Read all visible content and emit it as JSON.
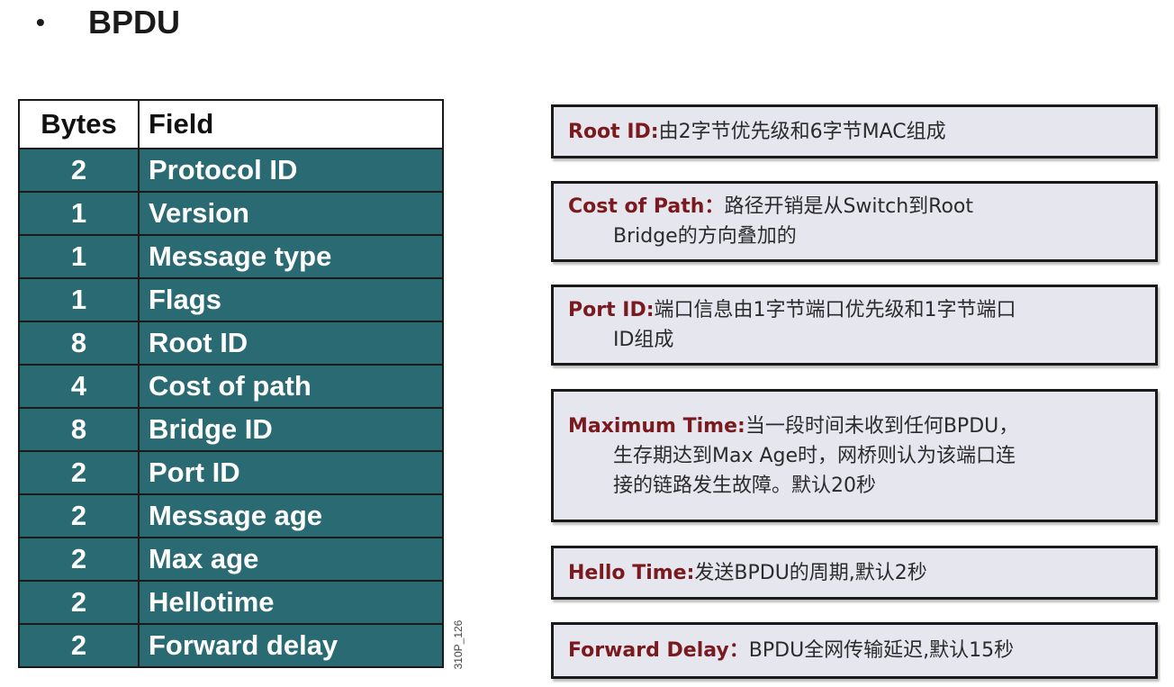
{
  "heading": {
    "bullet": "•",
    "text": "BPDU"
  },
  "table": {
    "headers": {
      "bytes": "Bytes",
      "field": "Field"
    },
    "rows": [
      {
        "bytes": "2",
        "field": "Protocol ID"
      },
      {
        "bytes": "1",
        "field": "Version"
      },
      {
        "bytes": "1",
        "field": "Message type"
      },
      {
        "bytes": "1",
        "field": "Flags"
      },
      {
        "bytes": "8",
        "field": "Root ID"
      },
      {
        "bytes": "4",
        "field": "Cost of path"
      },
      {
        "bytes": "8",
        "field": "Bridge ID"
      },
      {
        "bytes": "2",
        "field": "Port ID"
      },
      {
        "bytes": "2",
        "field": "Message age"
      },
      {
        "bytes": "2",
        "field": "Max age"
      },
      {
        "bytes": "2",
        "field": "Hellotime"
      },
      {
        "bytes": "2",
        "field": "Forward delay"
      }
    ]
  },
  "side_code": "310P_126",
  "notes": [
    {
      "term": "Root ID:",
      "lines": [
        "由2字节优先级和6字节MAC组成"
      ]
    },
    {
      "term": "Cost of Path：",
      "lines": [
        "路径开销是从Switch到Root",
        "Bridge的方向叠加的"
      ]
    },
    {
      "term": "Port ID:",
      "lines": [
        "端口信息由1字节端口优先级和1字节端口",
        "ID组成"
      ]
    },
    {
      "term": "Maximum Time:",
      "lines": [
        "当一段时间未收到任何BPDU，",
        "生存期达到Max Age时，网桥则认为该端口连",
        "接的链路发生故障。默认20秒"
      ]
    },
    {
      "term": "Hello Time:",
      "lines": [
        "发送BPDU的周期,默认2秒"
      ]
    },
    {
      "term": "Forward Delay：",
      "lines": [
        "BPDU全网传输延迟,默认15秒"
      ]
    }
  ],
  "colors": {
    "table_fill": "#2a6b73",
    "term_color": "#7a1a1f",
    "box_fill": "#e6e6ef"
  }
}
